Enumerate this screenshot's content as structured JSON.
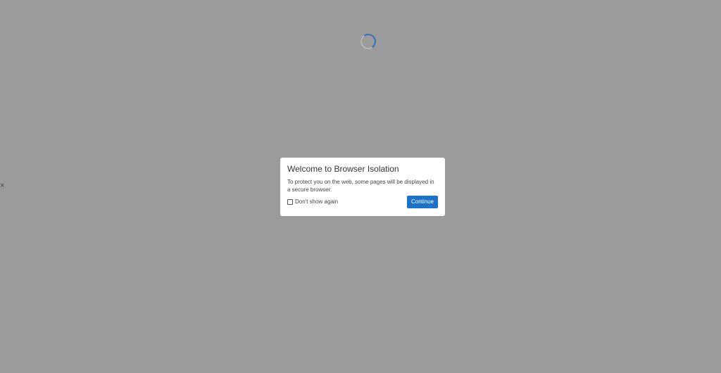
{
  "page": {
    "background_color": "#9b9b9b"
  },
  "loader": {
    "icon": "spinner-icon",
    "color": "#2f6fbf"
  },
  "stray_close": {
    "icon": "close-icon",
    "glyph": "×"
  },
  "dialog": {
    "title": "Welcome to Browser Isolation",
    "message": "To protect you on the web, some pages will be displayed in a secure browser.",
    "checkbox_label": "Don't show again",
    "checkbox_checked": false,
    "continue_label": "Continue",
    "accent_color": "#1a73c9"
  }
}
